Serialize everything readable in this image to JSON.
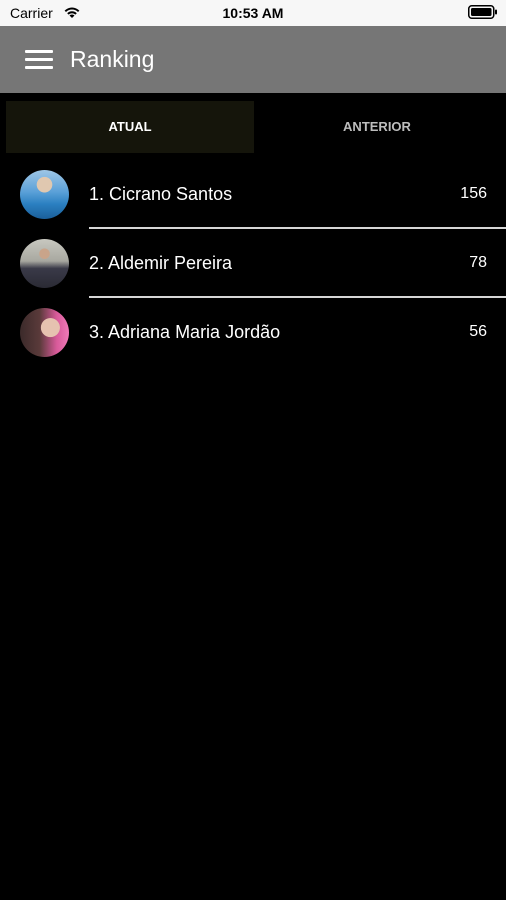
{
  "status_bar": {
    "carrier": "Carrier",
    "time": "10:53 AM",
    "wifi_icon": "wifi-icon",
    "battery_icon": "battery-icon"
  },
  "app_bar": {
    "menu_icon": "hamburger-menu-icon",
    "title": "Ranking",
    "background": "#767676"
  },
  "tabs": [
    {
      "label": "ATUAL",
      "selected": true
    },
    {
      "label": "ANTERIOR",
      "selected": false
    }
  ],
  "ranking": [
    {
      "name": "1. Cicrano Santos",
      "score": "156"
    },
    {
      "name": "2. Aldemir Pereira",
      "score": "78"
    },
    {
      "name": "3. Adriana Maria Jordão",
      "score": "56"
    }
  ],
  "colors": {
    "background": "#000000",
    "selected_tab": "#15150b",
    "divider": "#d6d6d6"
  }
}
